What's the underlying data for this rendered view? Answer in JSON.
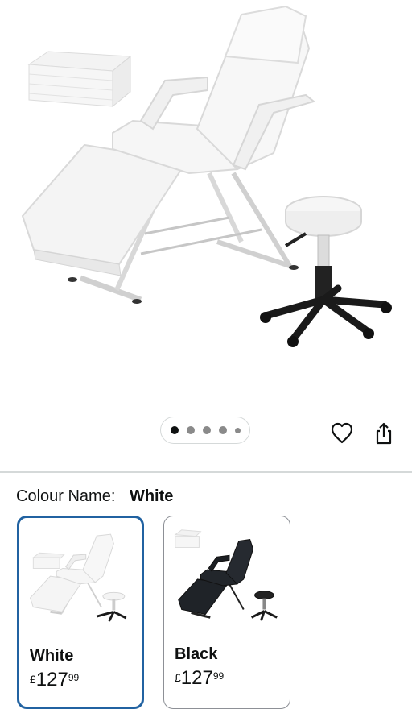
{
  "product": {
    "image_alt": "Beauty salon chair with stool",
    "carousel": {
      "total": 5,
      "active_index": 0
    }
  },
  "actions": {
    "wishlist_icon": "heart-icon",
    "share_icon": "share-icon"
  },
  "variation": {
    "label": "Colour Name:",
    "selected": "White"
  },
  "swatches": [
    {
      "name": "White",
      "currency": "£",
      "price_whole": "127",
      "price_fraction": "99"
    },
    {
      "name": "Black",
      "currency": "£",
      "price_whole": "127",
      "price_fraction": "99"
    }
  ],
  "colors": {
    "selected_border": "#2162a1",
    "unselected_border": "#8d9096",
    "text": "#0f1111"
  }
}
